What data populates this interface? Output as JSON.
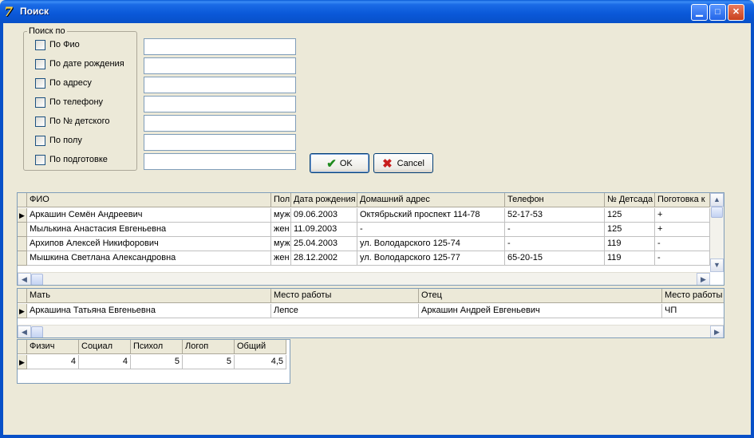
{
  "window": {
    "title": "Поиск",
    "app_icon": "7"
  },
  "search_group": {
    "legend": "Поиск по",
    "options": [
      {
        "label": "По Фио",
        "checked": false,
        "value": ""
      },
      {
        "label": "По дате рождения",
        "checked": false,
        "value": ""
      },
      {
        "label": "По адресу",
        "checked": false,
        "value": ""
      },
      {
        "label": "По телефону",
        "checked": false,
        "value": ""
      },
      {
        "label": "По № детского",
        "checked": false,
        "value": ""
      },
      {
        "label": "По полу",
        "checked": false,
        "value": ""
      },
      {
        "label": "По подготовке",
        "checked": false,
        "value": ""
      }
    ]
  },
  "buttons": {
    "ok_label": "OK",
    "cancel_label": "Cancel"
  },
  "children_grid": {
    "columns": [
      "ФИО",
      "Пол",
      "Дата рождения",
      "Домашний адрес",
      "Телефон",
      "№ Детсада",
      "Поготовка к"
    ],
    "rows": [
      [
        "Аркашин Семён Андреевич",
        "муж",
        "09.06.2003",
        "Октябрьский проспект 114-78",
        "52-17-53",
        "125",
        "+"
      ],
      [
        "Мылькина Анастасия Евгеньевна",
        "жен",
        "11.09.2003",
        "-",
        "-",
        "125",
        "+"
      ],
      [
        "Архипов Алексей Никифорович",
        "муж",
        "25.04.2003",
        "ул. Володарского 125-74",
        "-",
        "119",
        "-"
      ],
      [
        "Мышкина Светлана Александровна",
        "жен",
        "28.12.2002",
        "ул. Володарского 125-77",
        "65-20-15",
        "119",
        "-"
      ]
    ]
  },
  "parents_grid": {
    "columns": [
      "Мать",
      "Место работы",
      "Отец",
      "Место работы"
    ],
    "rows": [
      [
        "Аркашина Татьяна Евгеньевна",
        "Лепсе",
        "Аркашин Андрей Евгеньевич",
        "ЧП"
      ]
    ]
  },
  "scores_grid": {
    "columns": [
      "Физич",
      "Социал",
      "Психол",
      "Логоп",
      "Общий"
    ],
    "rows": [
      [
        "4",
        "4",
        "5",
        "5",
        "4,5"
      ]
    ]
  },
  "icons": {
    "row_indicator": "▶",
    "arrow_left": "◀",
    "arrow_right": "▶",
    "arrow_up": "▲",
    "arrow_down": "▼",
    "minimize": "▁",
    "maximize": "□",
    "close": "✕",
    "ok": "✔",
    "cancel": "✖"
  }
}
